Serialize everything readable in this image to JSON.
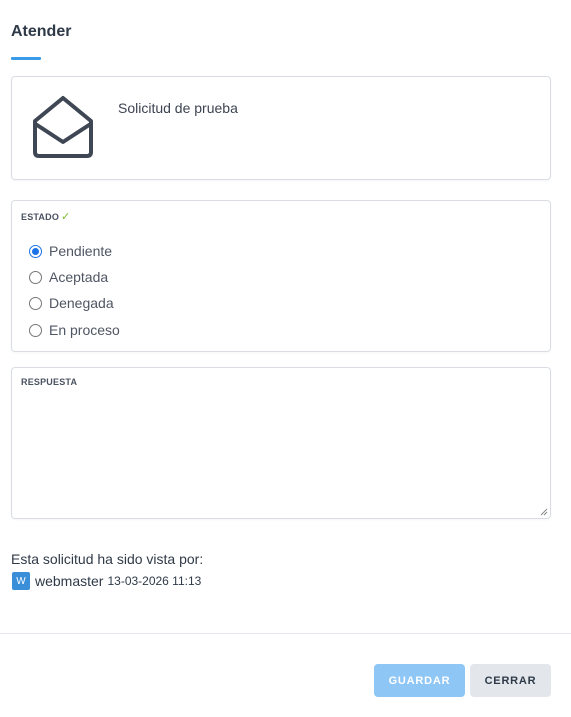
{
  "header": {
    "title": "Atender"
  },
  "request": {
    "subject": "Solicitud de prueba",
    "icon": "envelope-open-icon"
  },
  "estado": {
    "legend": "ESTADO",
    "check_glyph": "✓",
    "selected": "Pendiente",
    "options": [
      {
        "label": "Pendiente",
        "checked": true
      },
      {
        "label": "Aceptada",
        "checked": false
      },
      {
        "label": "Denegada",
        "checked": false
      },
      {
        "label": "En proceso",
        "checked": false
      }
    ]
  },
  "respuesta": {
    "legend": "RESPUESTA",
    "value": ""
  },
  "viewed": {
    "text": "Esta solicitud ha sido vista por:",
    "avatar_letter": "W",
    "user": "webmaster",
    "datetime": "13-03-2026 11:13"
  },
  "footer": {
    "save_label": "GUARDAR",
    "close_label": "CERRAR"
  },
  "colors": {
    "accent": "#3a9be8",
    "check": "#7dbb2c",
    "save_button": "#8ec6f6",
    "close_button": "#e3e7ec"
  }
}
